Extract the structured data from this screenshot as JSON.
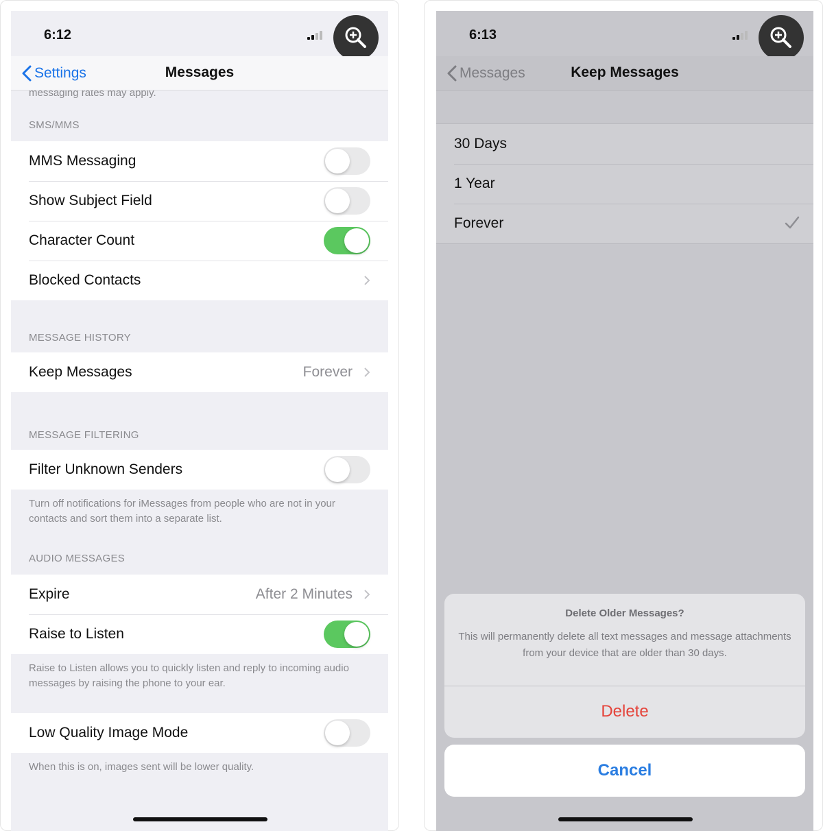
{
  "left": {
    "status_time": "6:12",
    "nav": {
      "back_label": "Settings",
      "title": "Messages"
    },
    "cut_footnote": "messaging rates may apply.",
    "sms_mms": {
      "header": "SMS/MMS",
      "rows": [
        {
          "label": "MMS Messaging",
          "toggle": false
        },
        {
          "label": "Show Subject Field",
          "toggle": false
        },
        {
          "label": "Character Count",
          "toggle": true
        },
        {
          "label": "Blocked Contacts"
        }
      ]
    },
    "message_history": {
      "header": "MESSAGE HISTORY",
      "keep_messages": {
        "label": "Keep Messages",
        "value": "Forever"
      }
    },
    "message_filtering": {
      "header": "MESSAGE FILTERING",
      "filter_unknown": {
        "label": "Filter Unknown Senders",
        "toggle": false
      },
      "footnote": "Turn off notifications for iMessages from people who are not in your contacts and sort them into a separate list."
    },
    "audio_messages": {
      "header": "AUDIO MESSAGES",
      "expire": {
        "label": "Expire",
        "value": "After 2 Minutes"
      },
      "raise_to_listen": {
        "label": "Raise to Listen",
        "toggle": true
      },
      "footnote": "Raise to Listen allows you to quickly listen and reply to incoming audio messages by raising the phone to your ear."
    },
    "low_quality": {
      "label": "Low Quality Image Mode",
      "toggle": false,
      "footnote": "When this is on, images sent will be lower quality."
    }
  },
  "right": {
    "status_time": "6:13",
    "nav": {
      "back_label": "Messages",
      "title": "Keep Messages"
    },
    "options": [
      "30 Days",
      "1 Year",
      "Forever"
    ],
    "selected": "Forever",
    "alert": {
      "title": "Delete Older Messages?",
      "message": "This will permanently delete all text messages and message attachments from your device that are older than 30 days.",
      "delete_label": "Delete",
      "cancel_label": "Cancel"
    }
  },
  "colors": {
    "ios_blue": "#2a7de1",
    "toggle_on": "#5bc85f",
    "destructive_red": "#e5433a"
  },
  "icons": [
    "zoom-in-icon",
    "chevron-left-icon",
    "chevron-right-icon",
    "checkmark-icon",
    "signal-icon",
    "wifi-icon"
  ]
}
